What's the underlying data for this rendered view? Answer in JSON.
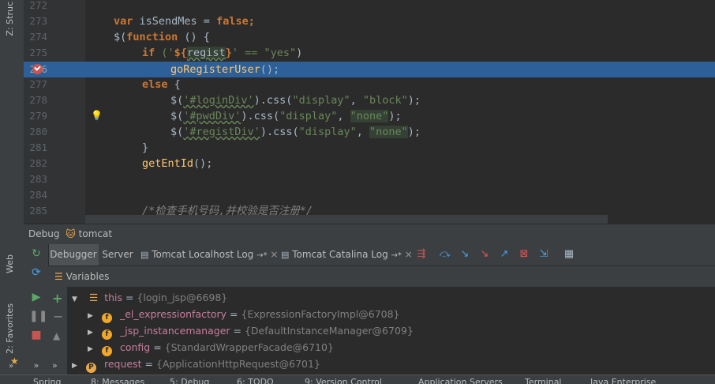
{
  "left_strip": {
    "structure_tab": "Z: Struc",
    "web_tab": "Web",
    "favorites_tab": "2: Favorites"
  },
  "editor": {
    "line_numbers": [
      "272",
      "273",
      "274",
      "275",
      "276",
      "277",
      "278",
      "279",
      "280",
      "281",
      "282",
      "283",
      "284",
      "285"
    ],
    "lines": {
      "l273": {
        "kw": "var",
        "name": " isSendMes = ",
        "val": "false",
        "end": ";"
      },
      "l274": {
        "a": "$(",
        "kw": "function",
        "b": " () {"
      },
      "l275": {
        "kw": "if",
        "a": " ('",
        "b": "${",
        "c": "regist",
        "d": "}",
        "e": "' == ",
        "f": "\"yes\"",
        "g": ")"
      },
      "l276": {
        "fn": "goRegisterUser",
        "end": "();"
      },
      "l277": {
        "kw": "else",
        "end": " {"
      },
      "l278": {
        "a": "$(",
        "s1": "'#loginDiv'",
        "b": ").css(",
        "s2": "\"display\"",
        "c": ", ",
        "s3": "\"block\"",
        "d": ");"
      },
      "l279": {
        "a": "$(",
        "s1": "'#pwdDiv'",
        "b": ").css(",
        "s2": "\"display\"",
        "c": ", ",
        "s3": "\"none\"",
        "d": ");"
      },
      "l280": {
        "a": "$(",
        "s1": "'#registDiv'",
        "b": ").css(",
        "s2": "\"display\"",
        "c": ", ",
        "s3": "\"none\"",
        "d": ");"
      },
      "l281": {
        "a": "}"
      },
      "l282": {
        "fn": "getEntId",
        "end": "();"
      },
      "l285": {
        "comment": "/*检查手机号码,并校验是否注册*/"
      }
    }
  },
  "debug": {
    "title": "Debug",
    "config": "tomcat",
    "tabs": [
      "Debugger",
      "Server",
      "Tomcat Localhost Log",
      "Tomcat Catalina Log"
    ],
    "tab_suffix": "→*",
    "variables_label": "Variables",
    "variables": [
      {
        "name": "this",
        "value": "{login_jsp@6698}"
      },
      {
        "name": "_el_expressionfactory",
        "value": "{ExpressionFactoryImpl@6708}"
      },
      {
        "name": "_jsp_instancemanager",
        "value": "{DefaultInstanceManager@6709}"
      },
      {
        "name": "config",
        "value": "{StandardWrapperFacade@6710}"
      },
      {
        "name": "request",
        "value": "{ApplicationHttpRequest@6701}"
      }
    ],
    "badge_f": "f",
    "badge_p": "P",
    "equals": " = "
  },
  "bottom_bar": [
    "Spring",
    "8: Messages",
    "5: Debug",
    "6: TODO",
    "9: Version Control",
    "Application Servers",
    "Terminal",
    "Java Enterprise"
  ],
  "colors": {
    "exec_line": "#2d6099",
    "breakpoint": "#c75450",
    "keyword": "#cc7832",
    "string": "#6a8759"
  }
}
